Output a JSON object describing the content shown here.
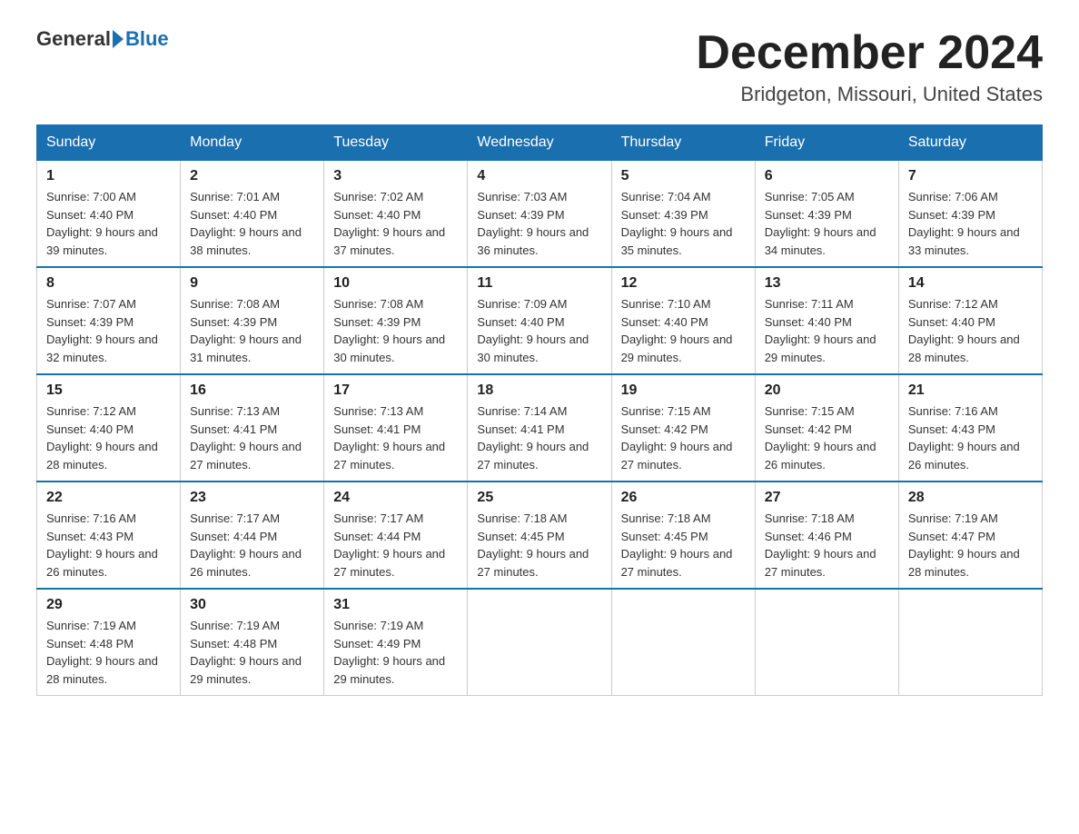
{
  "logo": {
    "general": "General",
    "blue": "Blue"
  },
  "title": "December 2024",
  "subtitle": "Bridgeton, Missouri, United States",
  "weekdays": [
    "Sunday",
    "Monday",
    "Tuesday",
    "Wednesday",
    "Thursday",
    "Friday",
    "Saturday"
  ],
  "weeks": [
    [
      {
        "day": "1",
        "sunrise": "7:00 AM",
        "sunset": "4:40 PM",
        "daylight": "9 hours and 39 minutes."
      },
      {
        "day": "2",
        "sunrise": "7:01 AM",
        "sunset": "4:40 PM",
        "daylight": "9 hours and 38 minutes."
      },
      {
        "day": "3",
        "sunrise": "7:02 AM",
        "sunset": "4:40 PM",
        "daylight": "9 hours and 37 minutes."
      },
      {
        "day": "4",
        "sunrise": "7:03 AM",
        "sunset": "4:39 PM",
        "daylight": "9 hours and 36 minutes."
      },
      {
        "day": "5",
        "sunrise": "7:04 AM",
        "sunset": "4:39 PM",
        "daylight": "9 hours and 35 minutes."
      },
      {
        "day": "6",
        "sunrise": "7:05 AM",
        "sunset": "4:39 PM",
        "daylight": "9 hours and 34 minutes."
      },
      {
        "day": "7",
        "sunrise": "7:06 AM",
        "sunset": "4:39 PM",
        "daylight": "9 hours and 33 minutes."
      }
    ],
    [
      {
        "day": "8",
        "sunrise": "7:07 AM",
        "sunset": "4:39 PM",
        "daylight": "9 hours and 32 minutes."
      },
      {
        "day": "9",
        "sunrise": "7:08 AM",
        "sunset": "4:39 PM",
        "daylight": "9 hours and 31 minutes."
      },
      {
        "day": "10",
        "sunrise": "7:08 AM",
        "sunset": "4:39 PM",
        "daylight": "9 hours and 30 minutes."
      },
      {
        "day": "11",
        "sunrise": "7:09 AM",
        "sunset": "4:40 PM",
        "daylight": "9 hours and 30 minutes."
      },
      {
        "day": "12",
        "sunrise": "7:10 AM",
        "sunset": "4:40 PM",
        "daylight": "9 hours and 29 minutes."
      },
      {
        "day": "13",
        "sunrise": "7:11 AM",
        "sunset": "4:40 PM",
        "daylight": "9 hours and 29 minutes."
      },
      {
        "day": "14",
        "sunrise": "7:12 AM",
        "sunset": "4:40 PM",
        "daylight": "9 hours and 28 minutes."
      }
    ],
    [
      {
        "day": "15",
        "sunrise": "7:12 AM",
        "sunset": "4:40 PM",
        "daylight": "9 hours and 28 minutes."
      },
      {
        "day": "16",
        "sunrise": "7:13 AM",
        "sunset": "4:41 PM",
        "daylight": "9 hours and 27 minutes."
      },
      {
        "day": "17",
        "sunrise": "7:13 AM",
        "sunset": "4:41 PM",
        "daylight": "9 hours and 27 minutes."
      },
      {
        "day": "18",
        "sunrise": "7:14 AM",
        "sunset": "4:41 PM",
        "daylight": "9 hours and 27 minutes."
      },
      {
        "day": "19",
        "sunrise": "7:15 AM",
        "sunset": "4:42 PM",
        "daylight": "9 hours and 27 minutes."
      },
      {
        "day": "20",
        "sunrise": "7:15 AM",
        "sunset": "4:42 PM",
        "daylight": "9 hours and 26 minutes."
      },
      {
        "day": "21",
        "sunrise": "7:16 AM",
        "sunset": "4:43 PM",
        "daylight": "9 hours and 26 minutes."
      }
    ],
    [
      {
        "day": "22",
        "sunrise": "7:16 AM",
        "sunset": "4:43 PM",
        "daylight": "9 hours and 26 minutes."
      },
      {
        "day": "23",
        "sunrise": "7:17 AM",
        "sunset": "4:44 PM",
        "daylight": "9 hours and 26 minutes."
      },
      {
        "day": "24",
        "sunrise": "7:17 AM",
        "sunset": "4:44 PM",
        "daylight": "9 hours and 27 minutes."
      },
      {
        "day": "25",
        "sunrise": "7:18 AM",
        "sunset": "4:45 PM",
        "daylight": "9 hours and 27 minutes."
      },
      {
        "day": "26",
        "sunrise": "7:18 AM",
        "sunset": "4:45 PM",
        "daylight": "9 hours and 27 minutes."
      },
      {
        "day": "27",
        "sunrise": "7:18 AM",
        "sunset": "4:46 PM",
        "daylight": "9 hours and 27 minutes."
      },
      {
        "day": "28",
        "sunrise": "7:19 AM",
        "sunset": "4:47 PM",
        "daylight": "9 hours and 28 minutes."
      }
    ],
    [
      {
        "day": "29",
        "sunrise": "7:19 AM",
        "sunset": "4:48 PM",
        "daylight": "9 hours and 28 minutes."
      },
      {
        "day": "30",
        "sunrise": "7:19 AM",
        "sunset": "4:48 PM",
        "daylight": "9 hours and 29 minutes."
      },
      {
        "day": "31",
        "sunrise": "7:19 AM",
        "sunset": "4:49 PM",
        "daylight": "9 hours and 29 minutes."
      },
      null,
      null,
      null,
      null
    ]
  ],
  "labels": {
    "sunrise": "Sunrise:",
    "sunset": "Sunset:",
    "daylight": "Daylight:"
  }
}
